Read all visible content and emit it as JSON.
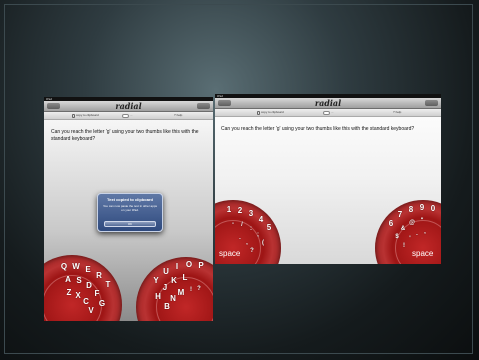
{
  "app": {
    "title": "radial",
    "nav_left_button": "",
    "nav_right_button": "",
    "status_time": "",
    "status_left": "iPad",
    "status_right": ""
  },
  "toolbar": {
    "copy_label": "copy to clipboard",
    "layout_label": "...",
    "help_label": "help"
  },
  "body_text": "Can you reach the letter 'g' using your two thumbs like this with the standard keyboard?",
  "alert": {
    "title": "Text copied to clipboard",
    "message": "You can now paste the text in other apps on your iPad.",
    "button": "OK"
  },
  "keyboard": {
    "space_label": "space",
    "left_wheel_keys": [
      "Q",
      "W",
      "E",
      "R",
      "T",
      "A",
      "S",
      "D",
      "F",
      "G",
      "Z",
      "X",
      "C",
      "V"
    ],
    "right_wheel_keys": [
      "Y",
      "U",
      "I",
      "O",
      "P",
      "H",
      "J",
      "K",
      "L",
      "B",
      "N",
      "M",
      "!",
      "?"
    ],
    "left_number_keys": [
      "1",
      "2",
      "3",
      "4",
      "5",
      "-",
      "/",
      ":",
      ";",
      "(",
      ".",
      ",",
      "?"
    ],
    "right_number_keys": [
      "6",
      "7",
      "8",
      "9",
      "0",
      "$",
      "&",
      "@",
      "\"",
      "!",
      "'",
      ".",
      ","
    ],
    "accent_color": "#b01e1e"
  }
}
